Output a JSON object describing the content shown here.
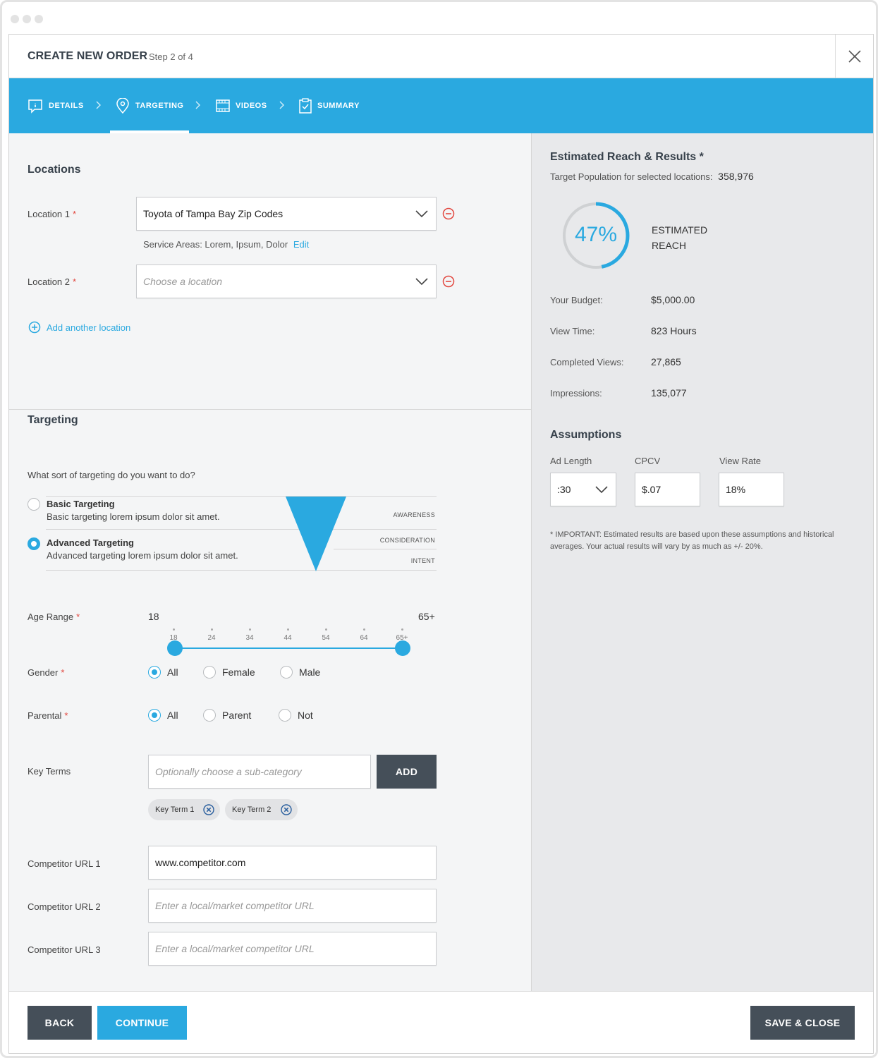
{
  "header": {
    "title": "CREATE NEW ORDER",
    "step": "Step 2 of 4"
  },
  "steps": [
    {
      "label": "DETAILS",
      "icon": "info-icon"
    },
    {
      "label": "TARGETING",
      "icon": "location-pin-icon",
      "active": true
    },
    {
      "label": "VIDEOS",
      "icon": "film-icon"
    },
    {
      "label": "SUMMARY",
      "icon": "clipboard-check-icon"
    }
  ],
  "locations": {
    "title": "Locations",
    "location1": {
      "label": "Location 1",
      "value": "Toyota of Tampa Bay Zip Codes"
    },
    "service_areas": "Service Areas: Lorem, Ipsum, Dolor",
    "edit": "Edit",
    "location2": {
      "label": "Location 2",
      "placeholder": "Choose a location"
    },
    "add_another": "Add another location",
    "required_mark": "*"
  },
  "targeting": {
    "title": "Targeting",
    "question": "What sort of targeting do you want to do?",
    "basic": {
      "title": "Basic Targeting",
      "desc": "Basic targeting lorem ipsum dolor sit amet."
    },
    "advanced": {
      "title": "Advanced Targeting",
      "desc": "Advanced targeting lorem ipsum dolor sit amet."
    },
    "funnel": [
      "AWARENESS",
      "CONSIDERATION",
      "INTENT"
    ],
    "age": {
      "label": "Age Range",
      "min": "18",
      "max": "65+",
      "ticks": [
        "18",
        "24",
        "34",
        "44",
        "54",
        "64",
        "65+"
      ]
    },
    "gender": {
      "label": "Gender",
      "options": [
        "All",
        "Female",
        "Male"
      ],
      "selected": "All"
    },
    "parental": {
      "label": "Parental",
      "options": [
        "All",
        "Parent",
        "Not"
      ],
      "selected": "All"
    },
    "key_terms": {
      "label": "Key Terms",
      "placeholder": "Optionally choose a sub-category",
      "add": "ADD",
      "chips": [
        "Key Term 1",
        "Key Term 2"
      ]
    },
    "competitors": [
      {
        "label": "Competitor URL 1",
        "value": "www.competitor.com"
      },
      {
        "label": "Competitor URL 2",
        "placeholder": "Enter a local/market competitor URL"
      },
      {
        "label": "Competitor URL 3",
        "placeholder": "Enter a local/market competitor URL"
      }
    ]
  },
  "reach": {
    "title": "Estimated Reach & Results *",
    "population_label": "Target Population for selected locations:",
    "population_value": "358,976",
    "percent": "47%",
    "percent_value": 0.47,
    "reach_label_1": "ESTIMATED",
    "reach_label_2": "REACH",
    "stats": [
      {
        "label": "Your Budget:",
        "value": "$5,000.00"
      },
      {
        "label": "View Time:",
        "value": "823 Hours"
      },
      {
        "label": "Completed Views:",
        "value": "27,865"
      },
      {
        "label": "Impressions:",
        "value": "135,077"
      }
    ]
  },
  "assumptions": {
    "title": "Assumptions",
    "ad_length": {
      "label": "Ad Length",
      "value": ":30"
    },
    "cpcv": {
      "label": "CPCV",
      "value": "$.07"
    },
    "view_rate": {
      "label": "View Rate",
      "value": "18%"
    },
    "note": "* IMPORTANT: Estimated results are based upon these assumptions and historical averages. Your actual results will vary by as much as +/- 20%."
  },
  "footer": {
    "back": "BACK",
    "continue": "CONTINUE",
    "save_close": "SAVE & CLOSE"
  },
  "colors": {
    "accent": "#2aa9e0",
    "dark_button": "#454f59",
    "required": "#e2473f"
  }
}
